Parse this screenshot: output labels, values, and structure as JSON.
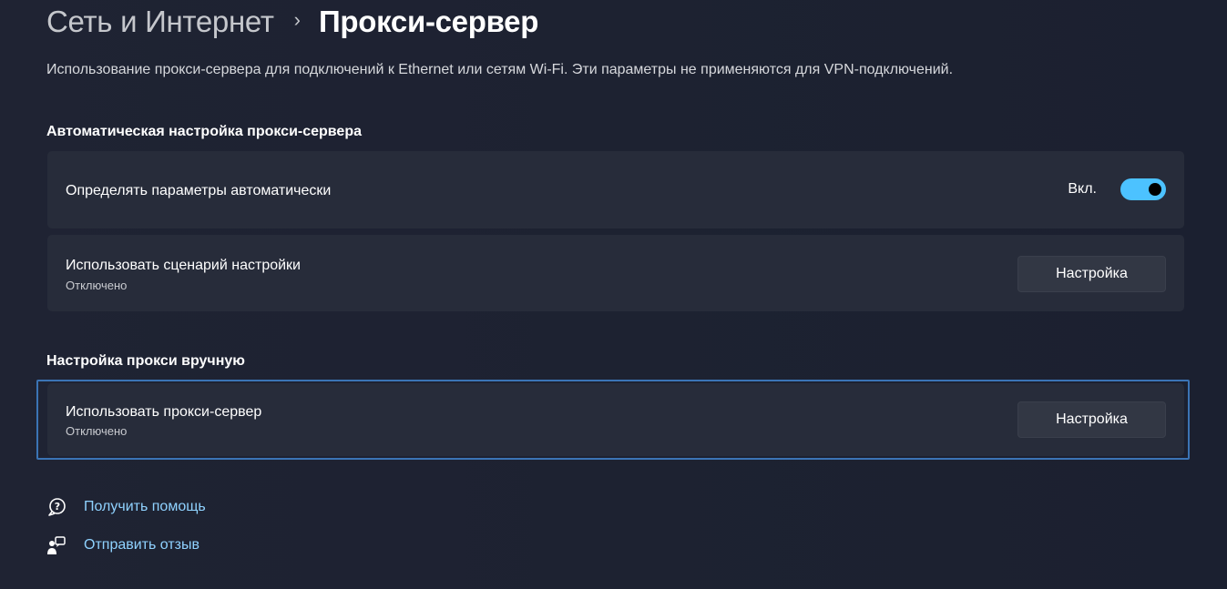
{
  "breadcrumb": {
    "parent": "Сеть и Интернет",
    "separator": "›",
    "current": "Прокси-сервер"
  },
  "description": "Использование прокси-сервера для подключений к Ethernet или сетям Wi-Fi. Эти параметры не применяются для VPN-подключений.",
  "auto_section": {
    "title": "Автоматическая настройка прокси-сервера",
    "detect": {
      "label": "Определять параметры автоматически",
      "state_label": "Вкл.",
      "on": true
    },
    "script": {
      "label": "Использовать сценарий настройки",
      "status": "Отключено",
      "button": "Настройка"
    }
  },
  "manual_section": {
    "title": "Настройка прокси вручную",
    "proxy": {
      "label": "Использовать прокси-сервер",
      "status": "Отключено",
      "button": "Настройка"
    }
  },
  "links": {
    "help": {
      "label": "Получить помощь",
      "icon": "help-chat-icon"
    },
    "feedback": {
      "label": "Отправить отзыв",
      "icon": "feedback-icon"
    }
  },
  "colors": {
    "accent": "#4cc2ff",
    "link": "#8fd2ff",
    "focus": "#3b74b5",
    "card": "#272c3a",
    "background": "#1d2231"
  }
}
